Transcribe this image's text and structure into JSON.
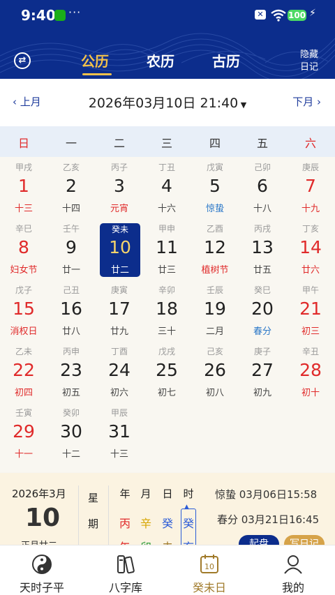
{
  "status": {
    "time": "9:40",
    "dots": "···",
    "battery": "100"
  },
  "header": {
    "tabs": [
      {
        "label": "公历",
        "active": true
      },
      {
        "label": "农历",
        "active": false
      },
      {
        "label": "古历",
        "active": false
      }
    ],
    "hide_diary": "隐藏日记",
    "accent": "#f2c14b",
    "brand": "#0c2d8c"
  },
  "nav": {
    "prev": "上月",
    "next": "下月",
    "current": "2026年03月10日 21:40"
  },
  "weekdays": [
    "日",
    "一",
    "二",
    "三",
    "四",
    "五",
    "六"
  ],
  "days": [
    {
      "gz": "甲戌",
      "day": "1",
      "lunar": "十三"
    },
    {
      "gz": "乙亥",
      "day": "2",
      "lunar": "十四"
    },
    {
      "gz": "丙子",
      "day": "3",
      "lunar": "元宵",
      "kind": "fest"
    },
    {
      "gz": "丁丑",
      "day": "4",
      "lunar": "十六"
    },
    {
      "gz": "戊寅",
      "day": "5",
      "lunar": "惊蛰",
      "kind": "term"
    },
    {
      "gz": "己卯",
      "day": "6",
      "lunar": "十八"
    },
    {
      "gz": "庚辰",
      "day": "7",
      "lunar": "十九"
    },
    {
      "gz": "辛巳",
      "day": "8",
      "lunar": "妇女节",
      "kind": "fest"
    },
    {
      "gz": "壬午",
      "day": "9",
      "lunar": "廿一"
    },
    {
      "gz": "癸未",
      "day": "10",
      "lunar": "廿二",
      "selected": true
    },
    {
      "gz": "甲申",
      "day": "11",
      "lunar": "廿三"
    },
    {
      "gz": "乙酉",
      "day": "12",
      "lunar": "植树节",
      "kind": "fest"
    },
    {
      "gz": "丙戌",
      "day": "13",
      "lunar": "廿五"
    },
    {
      "gz": "丁亥",
      "day": "14",
      "lunar": "廿六"
    },
    {
      "gz": "戊子",
      "day": "15",
      "lunar": "消权日",
      "kind": "fest"
    },
    {
      "gz": "己丑",
      "day": "16",
      "lunar": "廿八"
    },
    {
      "gz": "庚寅",
      "day": "17",
      "lunar": "廿九"
    },
    {
      "gz": "辛卯",
      "day": "18",
      "lunar": "三十"
    },
    {
      "gz": "壬辰",
      "day": "19",
      "lunar": "二月"
    },
    {
      "gz": "癸巳",
      "day": "20",
      "lunar": "春分",
      "kind": "term"
    },
    {
      "gz": "甲午",
      "day": "21",
      "lunar": "初三"
    },
    {
      "gz": "乙未",
      "day": "22",
      "lunar": "初四"
    },
    {
      "gz": "丙申",
      "day": "23",
      "lunar": "初五"
    },
    {
      "gz": "丁酉",
      "day": "24",
      "lunar": "初六"
    },
    {
      "gz": "戊戌",
      "day": "25",
      "lunar": "初七"
    },
    {
      "gz": "己亥",
      "day": "26",
      "lunar": "初八"
    },
    {
      "gz": "庚子",
      "day": "27",
      "lunar": "初九"
    },
    {
      "gz": "辛丑",
      "day": "28",
      "lunar": "初十"
    },
    {
      "gz": "壬寅",
      "day": "29",
      "lunar": "十一"
    },
    {
      "gz": "癸卯",
      "day": "30",
      "lunar": "十二"
    },
    {
      "gz": "甲辰",
      "day": "31",
      "lunar": "十三"
    }
  ],
  "info": {
    "ymonth": "2026年3月",
    "bigday": "10",
    "lunarday": "正月廿二",
    "week_chars": [
      "星",
      "期",
      "二"
    ],
    "pillar_heads": [
      "年",
      "月",
      "日",
      "时"
    ],
    "stems": [
      {
        "t": "丙",
        "color": "#e02a2a"
      },
      {
        "t": "辛",
        "color": "#d6a500"
      },
      {
        "t": "癸",
        "color": "#2a5bd7"
      },
      {
        "t": "癸",
        "color": "#2a5bd7"
      }
    ],
    "branches": [
      {
        "t": "午",
        "color": "#e02a2a"
      },
      {
        "t": "卯",
        "color": "#2a9a3a"
      },
      {
        "t": "未",
        "color": "#a07a2a"
      },
      {
        "t": "亥",
        "color": "#2a5bd7"
      }
    ],
    "term1": "惊蛰 03月06日15:58",
    "term2": "春分 03月21日16:45",
    "btn1": "起盘",
    "btn2": "写日记"
  },
  "tabbar": [
    {
      "label": "天时子平",
      "icon": "yinyang-icon",
      "active": false
    },
    {
      "label": "八字库",
      "icon": "books-icon",
      "active": false
    },
    {
      "label": "癸未日",
      "icon": "calendar-icon",
      "active": true,
      "icon_text": "10"
    },
    {
      "label": "我的",
      "icon": "user-icon",
      "active": false
    }
  ]
}
